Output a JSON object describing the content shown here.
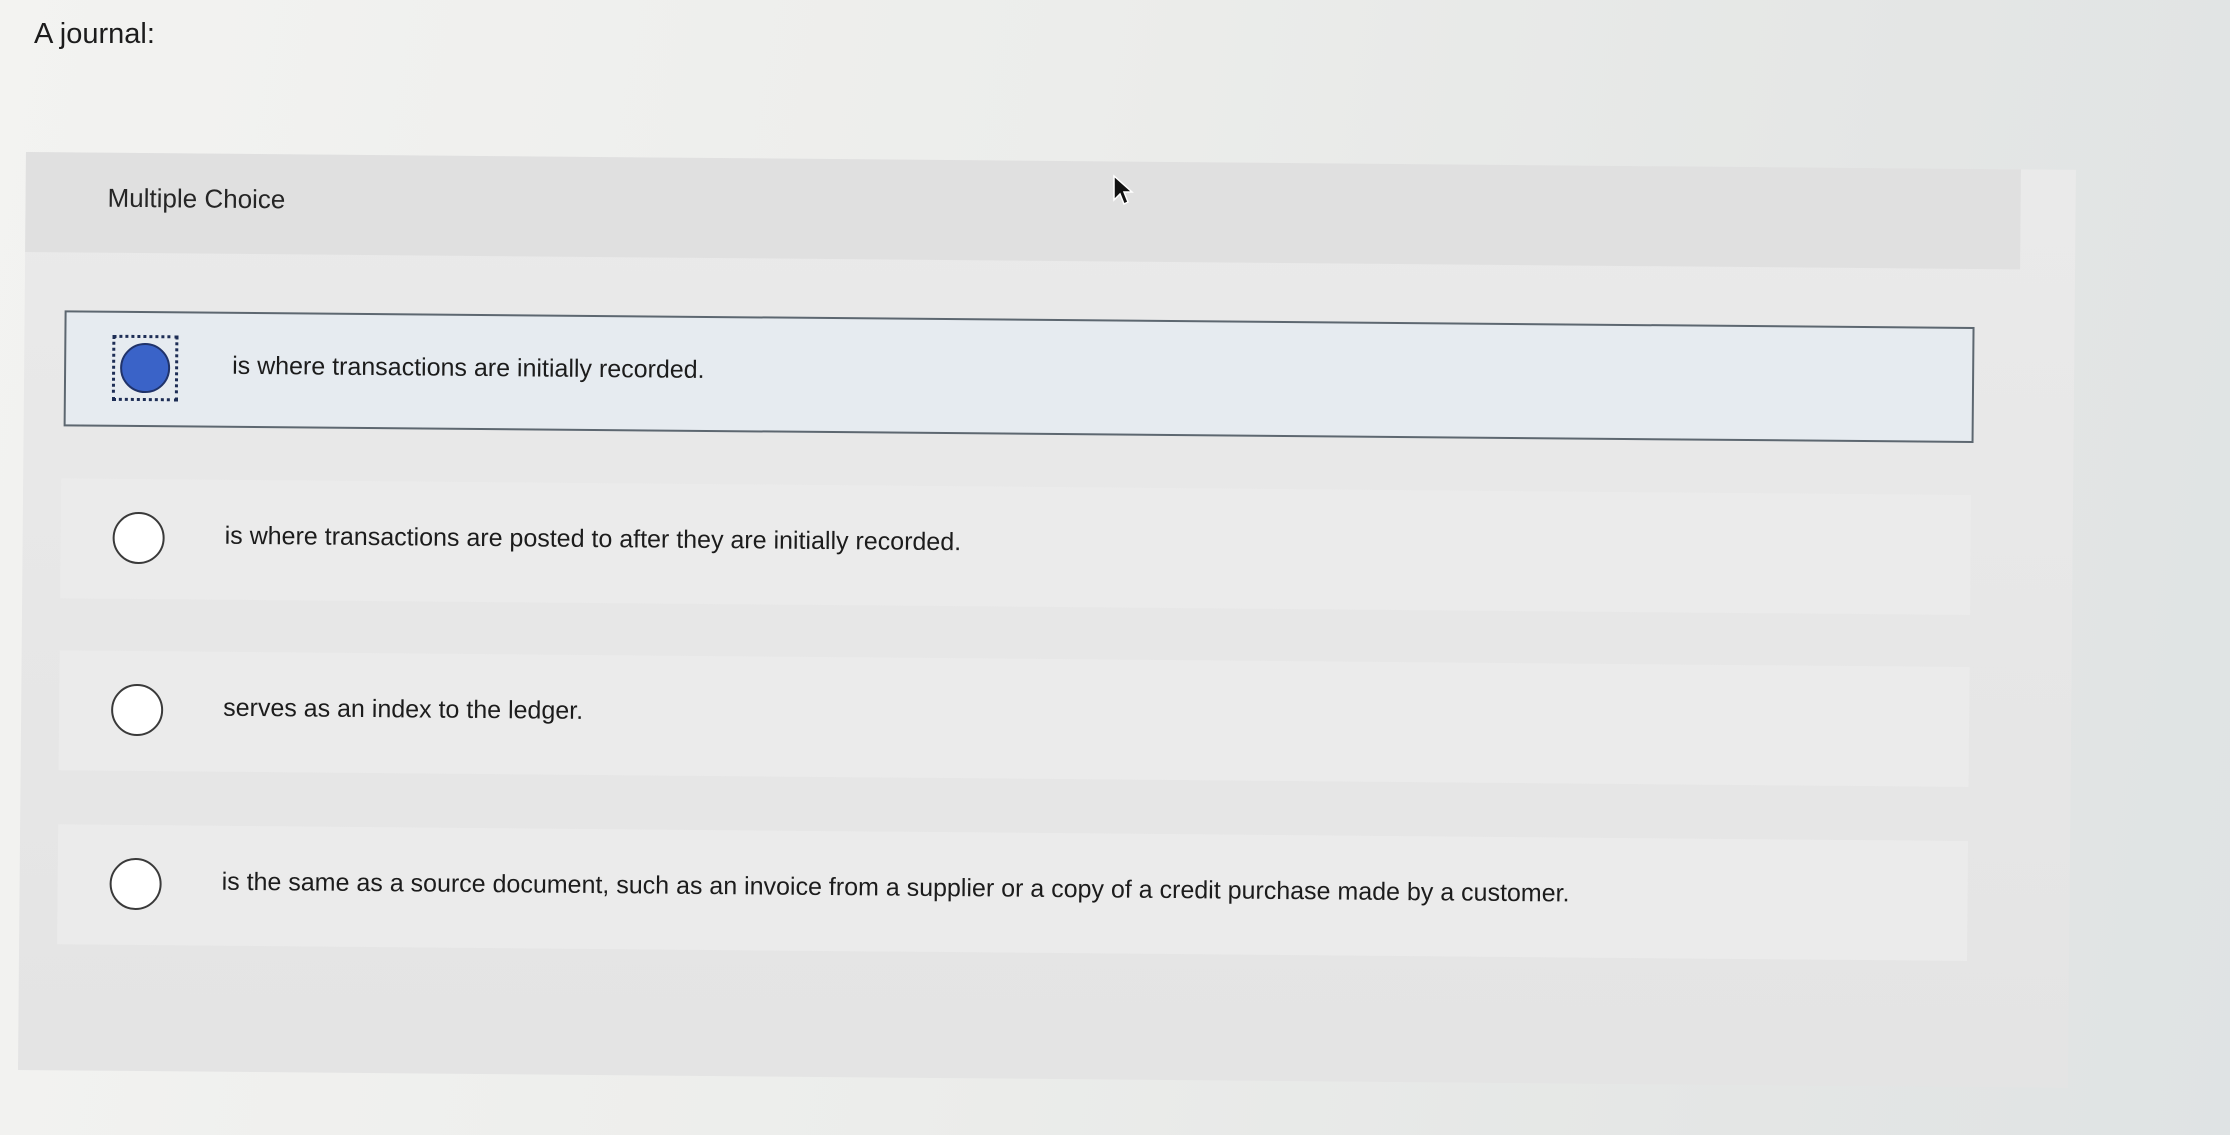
{
  "question": {
    "prompt": "A journal:"
  },
  "quiz": {
    "type_label": "Multiple Choice",
    "options": [
      {
        "label": "is where transactions are initially recorded.",
        "selected": true
      },
      {
        "label": "is where transactions are posted to after they are initially recorded.",
        "selected": false
      },
      {
        "label": "serves as an index to the ledger.",
        "selected": false
      },
      {
        "label": "is the same as a source document, such as an invoice from a supplier or a copy of a credit purchase made by a customer.",
        "selected": false
      }
    ]
  },
  "colors": {
    "selected_radio": "#3a63c8",
    "selected_row": "#e6ebf0",
    "row": "#ebebeb",
    "panel": "#e4e4e4"
  },
  "icons": {
    "cursor": "mouse-pointer-icon"
  }
}
